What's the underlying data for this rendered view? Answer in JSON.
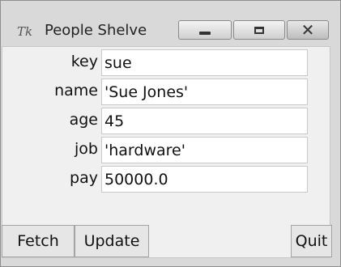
{
  "window": {
    "title": "People Shelve",
    "app_icon": "Tk",
    "controls": {
      "minimize": "minimize-icon",
      "maximize": "maximize-icon",
      "close": "close-icon"
    }
  },
  "form": {
    "fields": [
      {
        "label": "key",
        "value": "sue"
      },
      {
        "label": "name",
        "value": "'Sue Jones'"
      },
      {
        "label": "age",
        "value": "45"
      },
      {
        "label": "job",
        "value": "'hardware'"
      },
      {
        "label": "pay",
        "value": "50000.0"
      }
    ]
  },
  "buttons": {
    "fetch": "Fetch",
    "update": "Update",
    "quit": "Quit"
  },
  "colors": {
    "frame": "#d9d9d9",
    "client": "#f0f0f0",
    "field": "#ffffff"
  }
}
